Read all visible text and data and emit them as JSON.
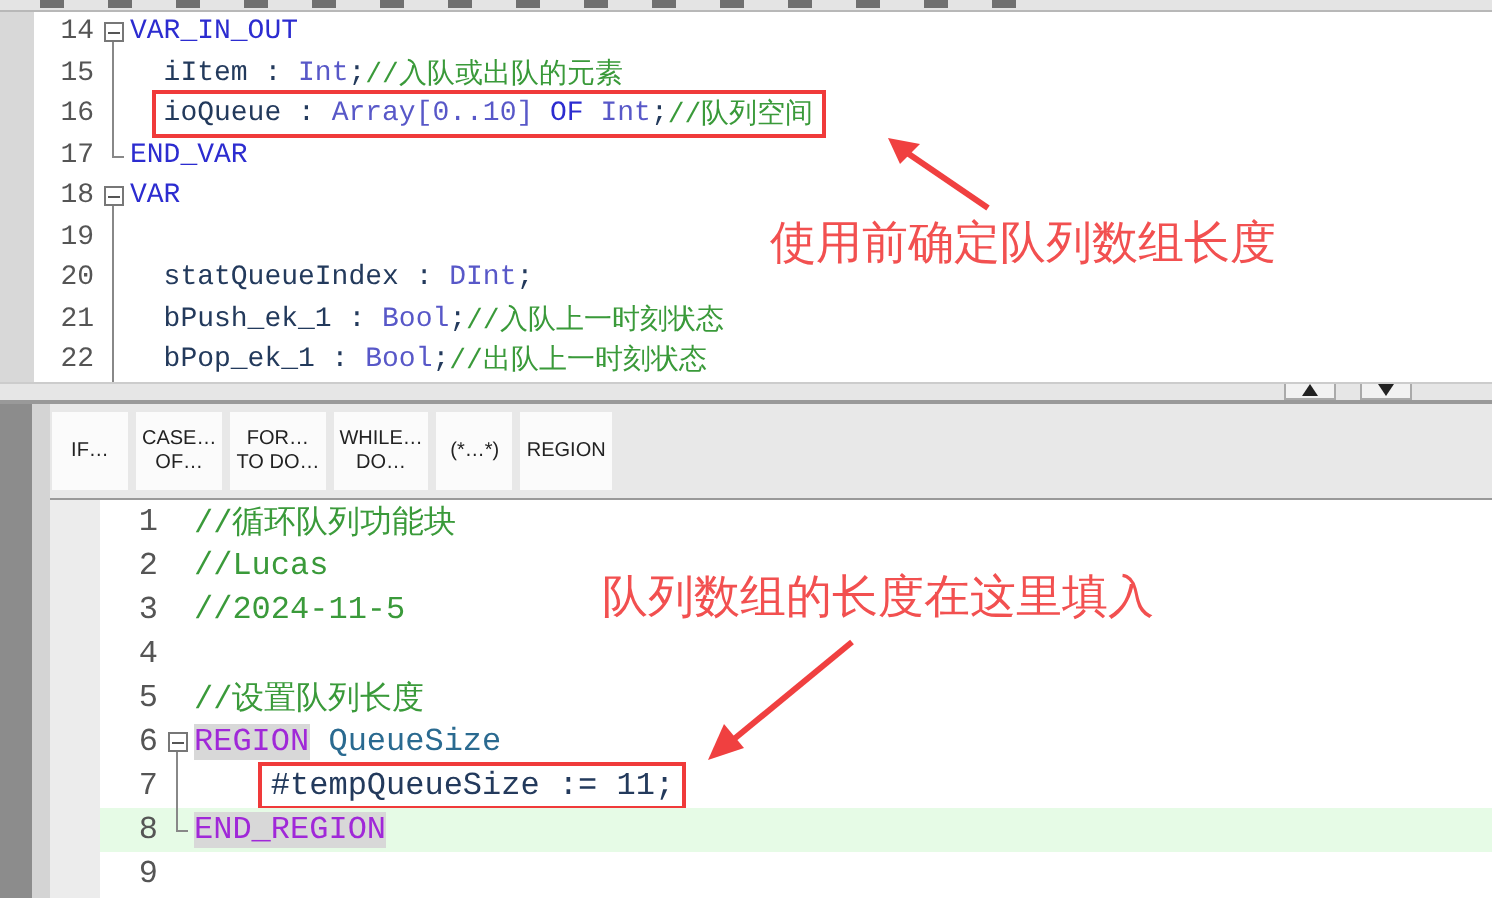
{
  "declarations": {
    "lines": [
      {
        "number": "14",
        "kind": "fold-start",
        "indented": false,
        "marked": false,
        "tokens": [
          {
            "kind": "keyword",
            "text": "VAR_IN_OUT"
          }
        ]
      },
      {
        "number": "15",
        "kind": "fold-line",
        "indented": true,
        "marked": false,
        "tokens": [
          {
            "kind": "ident",
            "text": "iItem : "
          },
          {
            "kind": "type",
            "text": "Int"
          },
          {
            "kind": "ident",
            "text": ";"
          },
          {
            "kind": "comment",
            "text": "//入队或出队的元素"
          }
        ]
      },
      {
        "number": "16",
        "kind": "fold-line",
        "indented": true,
        "marked": true,
        "tokens": [
          {
            "kind": "ident",
            "text": "ioQueue : "
          },
          {
            "kind": "type",
            "text": "Array[0..10] "
          },
          {
            "kind": "keyword",
            "text": "OF "
          },
          {
            "kind": "type",
            "text": "Int"
          },
          {
            "kind": "ident",
            "text": ";"
          },
          {
            "kind": "comment",
            "text": "//队列空间"
          }
        ]
      },
      {
        "number": "17",
        "kind": "fold-end",
        "indented": false,
        "marked": false,
        "tokens": [
          {
            "kind": "keyword",
            "text": "END_VAR"
          }
        ]
      },
      {
        "number": "18",
        "kind": "fold-start",
        "indented": false,
        "marked": false,
        "tokens": [
          {
            "kind": "keyword",
            "text": "VAR"
          }
        ]
      },
      {
        "number": "19",
        "kind": "fold-line"
      },
      {
        "number": "20",
        "kind": "fold-line",
        "indented": true,
        "marked": false,
        "tokens": [
          {
            "kind": "ident",
            "text": "statQueueIndex : "
          },
          {
            "kind": "type",
            "text": "DInt"
          },
          {
            "kind": "ident",
            "text": ";"
          }
        ]
      },
      {
        "number": "21",
        "kind": "fold-line",
        "indented": true,
        "marked": false,
        "tokens": [
          {
            "kind": "ident",
            "text": "bPush_ek_1 : "
          },
          {
            "kind": "type",
            "text": "Bool"
          },
          {
            "kind": "ident",
            "text": ";"
          },
          {
            "kind": "comment",
            "text": "//入队上一时刻状态"
          }
        ]
      },
      {
        "number": "22",
        "kind": "fold-line",
        "indented": true,
        "marked": false,
        "tokens": [
          {
            "kind": "ident",
            "text": "bPop_ek_1 : "
          },
          {
            "kind": "type",
            "text": "Bool"
          },
          {
            "kind": "ident",
            "text": ";"
          },
          {
            "kind": "comment",
            "text": "//出队上一时刻状态"
          }
        ]
      }
    ]
  },
  "snippets": [
    {
      "lines": [
        "IF…"
      ]
    },
    {
      "lines": [
        "CASE…",
        "OF…"
      ]
    },
    {
      "lines": [
        "FOR…",
        "TO DO…"
      ]
    },
    {
      "lines": [
        "WHILE…",
        "DO…"
      ]
    },
    {
      "lines": [
        "(*…*)"
      ]
    },
    {
      "lines": [
        "REGION"
      ]
    }
  ],
  "program": {
    "lines": [
      {
        "number": "1",
        "kind": "plain",
        "indented": false,
        "marked": false,
        "current": false,
        "tokens": [
          {
            "kind": "comment",
            "text": "//循环队列功能块"
          }
        ]
      },
      {
        "number": "2",
        "kind": "plain",
        "indented": false,
        "marked": false,
        "current": false,
        "tokens": [
          {
            "kind": "comment",
            "text": "//Lucas"
          }
        ]
      },
      {
        "number": "3",
        "kind": "plain",
        "indented": false,
        "marked": false,
        "current": false,
        "tokens": [
          {
            "kind": "comment",
            "text": "//2024-11-5"
          }
        ]
      },
      {
        "number": "4",
        "kind": "plain",
        "current": false
      },
      {
        "number": "5",
        "kind": "plain",
        "indented": false,
        "marked": false,
        "current": false,
        "tokens": [
          {
            "kind": "comment",
            "text": "//设置队列长度"
          }
        ]
      },
      {
        "number": "6",
        "kind": "fold-start",
        "indented": false,
        "marked": false,
        "current": false,
        "tokens": [
          {
            "kind": "region",
            "text": "REGION"
          },
          {
            "kind": "name",
            "text": " QueueSize"
          }
        ]
      },
      {
        "number": "7",
        "kind": "fold-line",
        "indented": true,
        "marked": true,
        "current": false,
        "tokens": [
          {
            "kind": "ident",
            "text": "#tempQueueSize := 11;"
          }
        ]
      },
      {
        "number": "8",
        "kind": "fold-end",
        "indented": false,
        "marked": false,
        "current": true,
        "tokens": [
          {
            "kind": "region",
            "text": "END_REGION"
          }
        ]
      },
      {
        "number": "9",
        "kind": "plain",
        "current": false
      }
    ]
  },
  "annotations": [
    {
      "text": "使用前确定队列数组长度"
    },
    {
      "text": "队列数组的长度在这里填入"
    }
  ]
}
